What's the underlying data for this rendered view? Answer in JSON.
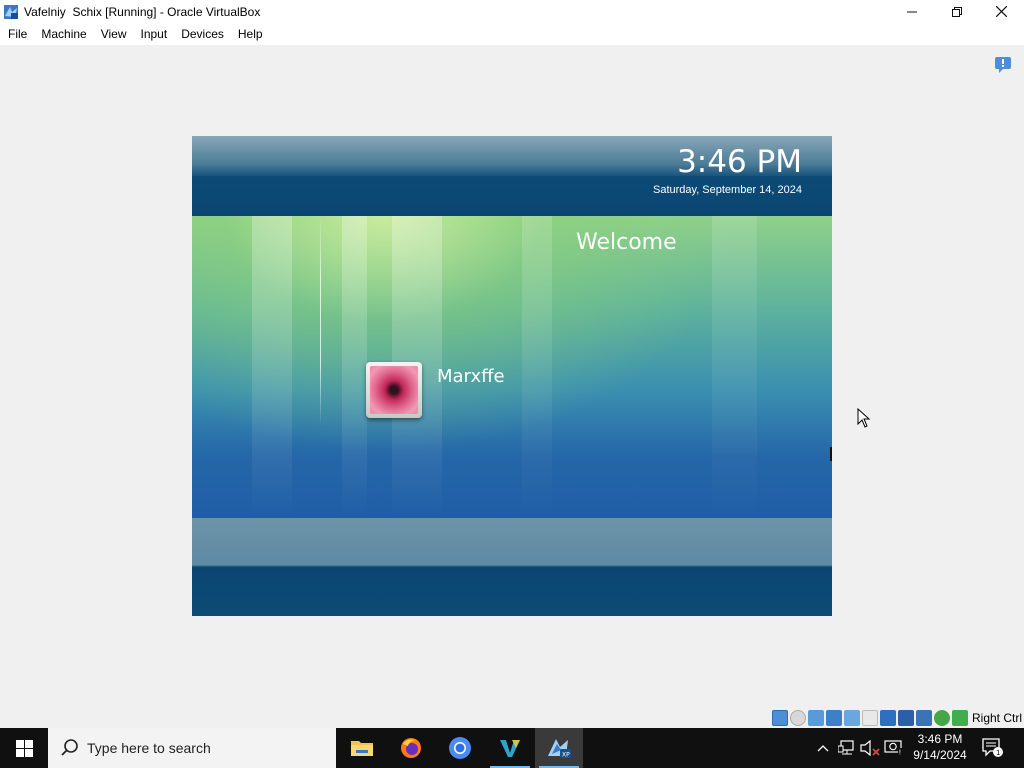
{
  "window": {
    "title": "Vafelniy  Schix [Running] - Oracle VirtualBox",
    "icon": "virtualbox-vm-icon",
    "controls": [
      "minimize-icon",
      "restore-icon",
      "close-icon"
    ]
  },
  "menubar": {
    "items": [
      {
        "label": "File"
      },
      {
        "label": "Machine"
      },
      {
        "label": "View"
      },
      {
        "label": "Input"
      },
      {
        "label": "Devices"
      },
      {
        "label": "Help"
      }
    ]
  },
  "hint_icon": "notification-balloon-icon",
  "vm": {
    "time": "3:46 PM",
    "date": "Saturday, September 14, 2024",
    "welcome": "Welcome",
    "user": {
      "name": "Marxffe",
      "picture": "pink-flower-avatar"
    },
    "colors": {
      "top_bar": "#0b4673",
      "glow_green": "#8fd08a",
      "glow_blue": "#1f5ea6"
    }
  },
  "statusbar": {
    "icons": [
      "hard-disk-icon",
      "optical-drive-icon",
      "audio-icon",
      "network-icon",
      "usb-icon",
      "shared-folders-icon",
      "display-icon",
      "video-capture-icon",
      "cpu-icon",
      "mouse-integration-icon",
      "keyboard-icon"
    ],
    "host_key": "Right Ctrl"
  },
  "taskbar": {
    "search_placeholder": "Type here to search",
    "apps": [
      {
        "name": "file-explorer-icon",
        "active": false
      },
      {
        "name": "firefox-icon",
        "active": false
      },
      {
        "name": "chrome-icon",
        "active": false
      },
      {
        "name": "virtualbox-manager-icon",
        "active": false,
        "running": true
      },
      {
        "name": "virtualbox-vm-icon",
        "active": true
      }
    ],
    "tray_icons": [
      "show-hidden-icons-icon",
      "network-icon",
      "volume-muted-icon",
      "alert-icon"
    ],
    "clock": {
      "time": "3:46 PM",
      "date": "9/14/2024"
    },
    "notifications_count": "1"
  }
}
